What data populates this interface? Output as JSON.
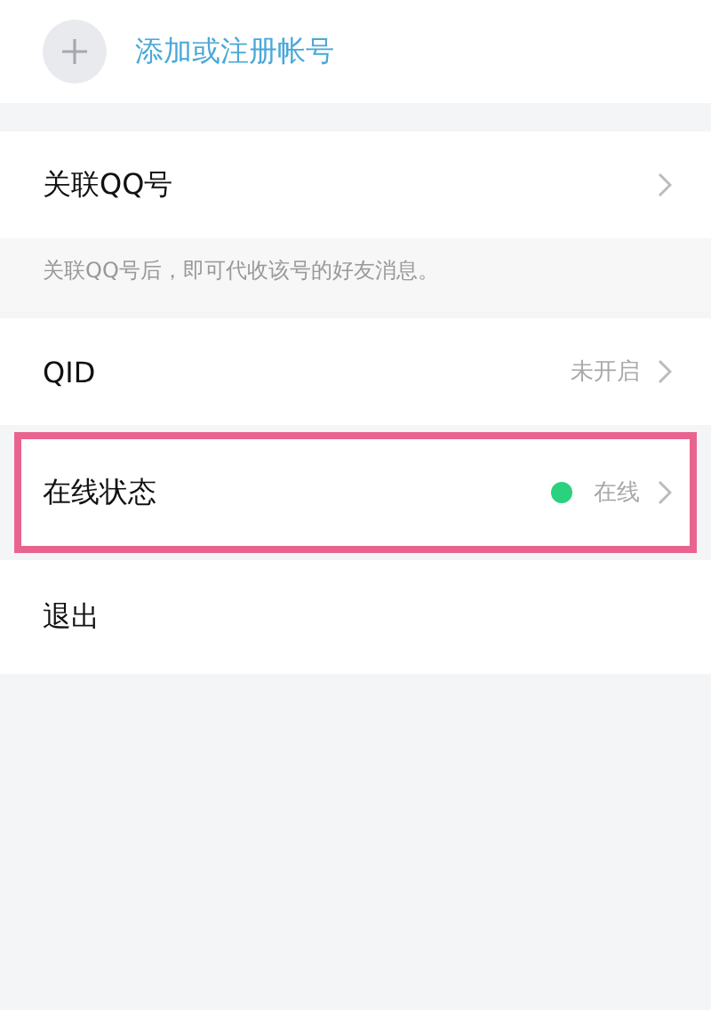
{
  "add_account": {
    "label": "添加或注册帐号"
  },
  "rows": [
    {
      "kind": "link",
      "label": "关联QQ号",
      "highlighted": false,
      "hint": "关联QQ号后，即可代收该号的好友消息。"
    },
    {
      "kind": "value",
      "label": "QID",
      "value": "未开启",
      "highlighted": false
    },
    {
      "kind": "status",
      "label": "在线状态",
      "value": "在线",
      "color": "#2bd17e",
      "highlighted": true
    },
    {
      "kind": "plain",
      "label": "退出",
      "highlighted": false
    }
  ]
}
